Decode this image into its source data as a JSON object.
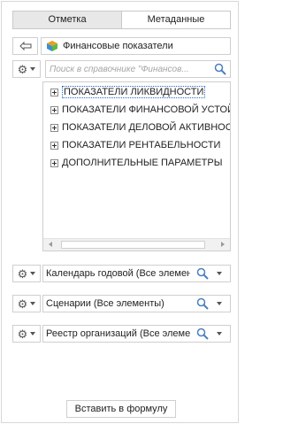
{
  "tabs": [
    {
      "label": "Отметка",
      "active": true
    },
    {
      "label": "Метаданные",
      "active": false
    }
  ],
  "path": {
    "back_icon": "back-arrow-icon",
    "dictionary_icon": "cube-icon",
    "label": "Финансовые показатели"
  },
  "search": {
    "placeholder": "Поиск в справочнике \"Финансов...",
    "icon": "search-icon"
  },
  "tree": {
    "items": [
      {
        "label": "ПОКАЗАТЕЛИ ЛИКВИДНОСТИ",
        "selected": true
      },
      {
        "label": "ПОКАЗАТЕЛИ ФИНАНСОВОЙ УСТОЙ"
      },
      {
        "label": "ПОКАЗАТЕЛИ ДЕЛОВОЙ АКТИВНОСТ"
      },
      {
        "label": "ПОКАЗАТЕЛИ РЕНТАБЕЛЬНОСТИ"
      },
      {
        "label": "ДОПОЛНИТЕЛЬНЫЕ ПАРАМЕТРЫ"
      }
    ]
  },
  "dimensions": [
    {
      "label": "Календарь годовой (Все элемент"
    },
    {
      "label": "Сценарии (Все элементы)"
    },
    {
      "label": "Реестр организаций (Все элемен"
    }
  ],
  "footer": {
    "insert_label": "Вставить в формулу"
  },
  "colors": {
    "accent": "#2a66c9",
    "border": "#cfcfcf",
    "tab_active_bg": "#e8e8e8"
  }
}
